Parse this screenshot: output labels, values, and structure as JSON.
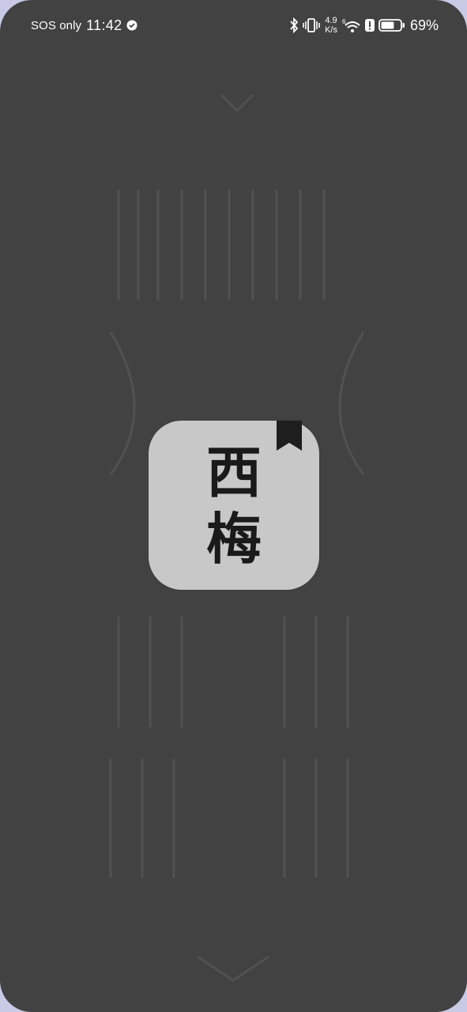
{
  "status_bar": {
    "carrier": "SOS only",
    "time": "11:42",
    "net_speed_value": "4.9",
    "net_speed_unit": "K/s",
    "battery_percent": "69%",
    "battery_level": 0.69,
    "icons": [
      "vpn-shield-icon",
      "bluetooth-icon",
      "vibrate-icon",
      "wifi-6-icon",
      "alert-icon",
      "battery-icon"
    ]
  },
  "splash": {
    "app_logo_chars": [
      "西",
      "梅"
    ],
    "bookmark": "bookmark-icon"
  },
  "colors": {
    "background": "#424242",
    "icon_bg": "#c8c8c8",
    "logo_text": "#1a1a1a"
  }
}
